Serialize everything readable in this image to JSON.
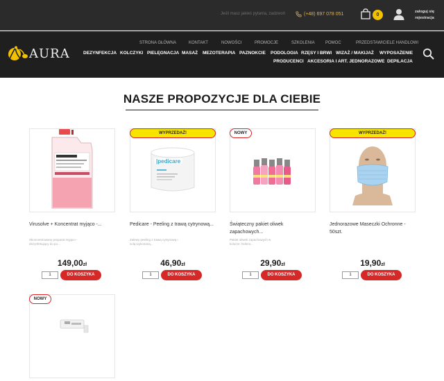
{
  "header": {
    "question_text": "Jeśli masz jakieś pytania, zadzwoń",
    "phone": "(+48) 697 078 051",
    "cart_count": "0",
    "login_line1": "zaloguj się",
    "login_line2": "rejestracja",
    "logo_text": "AURA"
  },
  "nav": {
    "secondary": [
      "STRONA GŁÓWNA",
      "KONTAKT",
      "NOWOŚCI",
      "PROMOCJE",
      "SZKOLENIA",
      "POMOC",
      "PRZEDSTAWICIELE HANDLOWI"
    ],
    "main_row1": [
      "DEZYNFEKCJA",
      "KOLCZYKI",
      "PIELĘGNACJA",
      "MASAŻ",
      "MEZOTERAPIA",
      "PAZNOKCIE",
      "PODOLOGIA",
      "RZĘSY I BRWI",
      "WIZAŻ / MAKIJAŻ",
      "WYPOSAŻENIE"
    ],
    "main_row2": [
      "PRODUCENCI",
      "AKCESORIA I ART. JEDNORAZOWE",
      "DEPILACJA"
    ]
  },
  "section": {
    "title": "NASZE PROPOZYCJE DLA CIEBIE"
  },
  "products": [
    {
      "badge": "",
      "name": "Virusolve + Koncentrat myjąco -...",
      "desc": "Skoncentrowany preparat myjąco - dezynfekujący do po...",
      "price": "149,00",
      "currency": "zł",
      "qty": "1",
      "button": "DO KOSZYKA"
    },
    {
      "badge": "WYPRZEDAŻ!",
      "name": "Pedicare - Peeling z trawą cytrynową...",
      "desc": "Zalewy peeling z trawą cytrynową i solą wykonaną...",
      "price": "46,90",
      "currency": "zł",
      "qty": "1",
      "button": "DO KOSZYKA"
    },
    {
      "badge": "NOWY",
      "name": "Świąteczny pakiet oliwek zapachowych...",
      "desc": "Pakiet oliwek zapachowych w kolorze: hiokmi...",
      "price": "29,90",
      "currency": "zł",
      "qty": "1",
      "button": "DO KOSZYKA"
    },
    {
      "badge": "WYPRZEDAŻ!",
      "name": "Jednorazowe Maseczki Ochronne - 50szt.",
      "desc": "",
      "price": "19,90",
      "currency": "zł",
      "qty": "1",
      "button": "DO KOSZYKA"
    },
    {
      "badge": "NOWY"
    }
  ],
  "colors": {
    "header_bg": "#2b2b2b",
    "nav_bg": "#1f1f1f",
    "accent_yellow": "#f2c200",
    "button_red": "#d72828",
    "phone_orange": "#e8b34a"
  }
}
